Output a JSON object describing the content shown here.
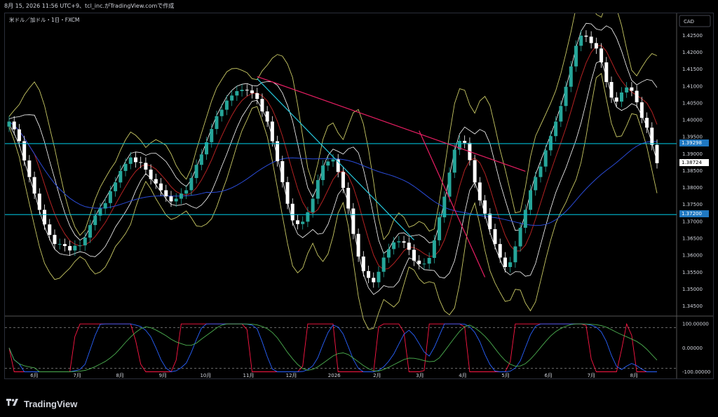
{
  "header": {
    "watermark": "8月 15, 2026 11:56 UTC+9、tcl_inc.がTradingView.comで作成"
  },
  "chart_title": "米ドル／加ドル・1日・FXCM",
  "currency_button": "CAD",
  "footer": {
    "brand": "TradingView"
  },
  "colors": {
    "background": "#000000",
    "up_candle": "#26a69a",
    "down_candle": "#ffffff",
    "bb_outer": "#c8c864",
    "bb_inner": "#ffffff",
    "ma_short": "#b22222",
    "ma_long": "#2a4bd7",
    "hline": "#00bcd4",
    "trend_red": "#e91e63",
    "trend_cyan": "#26c6da",
    "osc_red": "#ff1744",
    "osc_blue": "#2962ff",
    "osc_green": "#4caf50"
  },
  "chart_data": {
    "type": "candlestick",
    "price_axis": {
      "ticks": [
        "1.42500",
        "1.42000",
        "1.41500",
        "1.41000",
        "1.40500",
        "1.40000",
        "1.39500",
        "1.39000",
        "1.38500",
        "1.38000",
        "1.37500",
        "1.37000",
        "1.36500",
        "1.36000",
        "1.35500",
        "1.35000",
        "1.34500"
      ],
      "range": [
        1.342,
        1.4315
      ]
    },
    "time_axis": {
      "labels": [
        "6月",
        "7月",
        "8月",
        "9月",
        "10月",
        "11月",
        "12月",
        "2026",
        "2月",
        "3月",
        "4月",
        "5月",
        "6月",
        "7月",
        "8月"
      ]
    },
    "price_tags": [
      {
        "value": "1.39298",
        "price": 1.39298,
        "style": "hline"
      },
      {
        "value": "1.38724",
        "price": 1.38724,
        "style": "last"
      },
      {
        "value": "1.37200",
        "price": 1.372,
        "style": "hline"
      }
    ],
    "horizontal_lines": [
      1.39298,
      1.372
    ],
    "series_close": [
      1.3995,
      1.3972,
      1.3937,
      1.388,
      1.3831,
      1.3782,
      1.3734,
      1.3691,
      1.366,
      1.3633,
      1.3633,
      1.3627,
      1.3614,
      1.3628,
      1.3629,
      1.3652,
      1.3689,
      1.3717,
      1.3738,
      1.3754,
      1.3789,
      1.3815,
      1.3849,
      1.387,
      1.3889,
      1.3875,
      1.3873,
      1.3853,
      1.3825,
      1.3812,
      1.3792,
      1.3774,
      1.3759,
      1.3767,
      1.3782,
      1.3792,
      1.3828,
      1.3867,
      1.3898,
      1.3934,
      1.3973,
      1.4011,
      1.403,
      1.4057,
      1.4072,
      1.4085,
      1.4089,
      1.4087,
      1.4079,
      1.4062,
      1.4025,
      1.3995,
      1.3937,
      1.3878,
      1.3816,
      1.3752,
      1.3703,
      1.3692,
      1.3699,
      1.3727,
      1.3767,
      1.3822,
      1.3865,
      1.3877,
      1.3883,
      1.3846,
      1.3799,
      1.3738,
      1.3663,
      1.3596,
      1.3553,
      1.3533,
      1.352,
      1.3551,
      1.3593,
      1.3618,
      1.3638,
      1.3641,
      1.3637,
      1.3616,
      1.3584,
      1.3574,
      1.3575,
      1.3592,
      1.3644,
      1.3712,
      1.3773,
      1.3844,
      1.3912,
      1.3938,
      1.3932,
      1.3881,
      1.3815,
      1.3762,
      1.3723,
      1.3677,
      1.3633,
      1.3593,
      1.3565,
      1.3579,
      1.3626,
      1.3681,
      1.3734,
      1.3792,
      1.3831,
      1.3862,
      1.391,
      1.3952,
      1.3995,
      1.4041,
      1.4098,
      1.4158,
      1.4219,
      1.4249,
      1.4246,
      1.4227,
      1.4211,
      1.417,
      1.4112,
      1.4066,
      1.4054,
      1.4081,
      1.4096,
      1.4086,
      1.4052,
      1.4006,
      1.3977,
      1.3926,
      1.3872
    ],
    "indicators": [
      "Bollinger Bands (outer)",
      "Bollinger Bands (inner)",
      "Moving Average (short)",
      "Moving Average (long)"
    ],
    "oscillator": {
      "ticks": [
        "100.00000",
        "0.00000",
        "-100.00000"
      ],
      "range": [
        -125,
        130
      ],
      "levels": [
        85,
        -85
      ],
      "series_names": [
        "red",
        "blue",
        "green"
      ]
    }
  }
}
